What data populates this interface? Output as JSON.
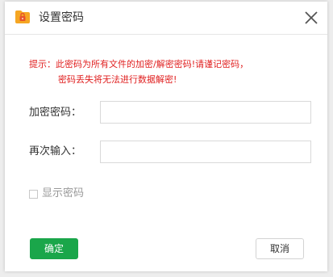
{
  "window": {
    "title": "设置密码",
    "icon": "folder-lock-icon",
    "close_icon": "close-icon"
  },
  "tip": {
    "line1": "提示：此密码为所有文件的加密/解密密码!请谨记密码，",
    "line2": "密码丢失将无法进行数据解密!",
    "color": "#e02020"
  },
  "form": {
    "password_label": "加密密码：",
    "password_value": "",
    "confirm_label": "再次输入：",
    "confirm_value": "",
    "show_password_label": "显示密码",
    "show_password_checked": false
  },
  "buttons": {
    "ok_label": "确定",
    "cancel_label": "取消"
  },
  "colors": {
    "accent": "#1aa64a",
    "icon_folder": "#f5a623",
    "icon_lock": "#e8532b"
  }
}
